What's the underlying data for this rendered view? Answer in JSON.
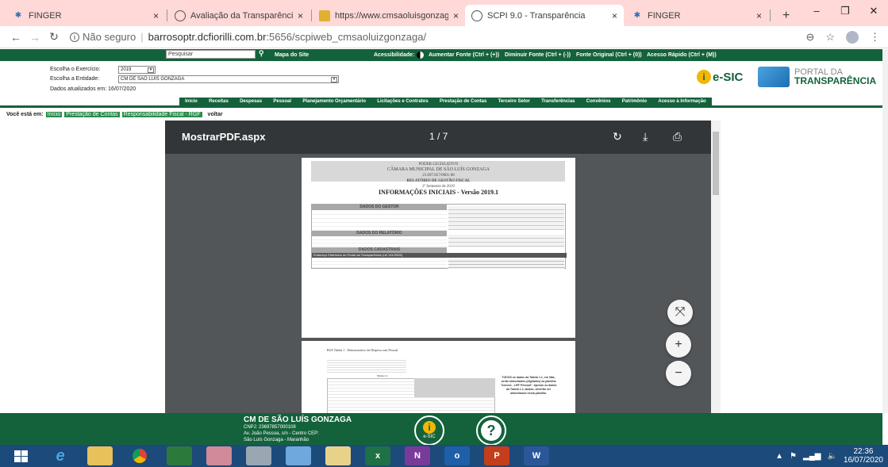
{
  "browser": {
    "tabs": [
      {
        "label": "FINGER",
        "close": "×"
      },
      {
        "label": "Avaliação da Transparência dos",
        "close": "×"
      },
      {
        "label": "https://www.cmsaoluisgonzaga",
        "close": "×"
      },
      {
        "label": "SCPI 9.0 - Transparência",
        "close": "×"
      },
      {
        "label": "FINGER",
        "close": "×"
      }
    ],
    "new_tab": "+",
    "window_controls": [
      "–",
      "❐",
      "✕"
    ],
    "security": "Não seguro",
    "url_host": "barrosoptr.dcfiorilli.com.br",
    "url_rest": ":5656/scpiweb_cmsaoluizgonzaga/"
  },
  "topstrip": {
    "search_placeholder": "Pesquisar",
    "sitemap": "Mapa do Site",
    "accessibility": "Acessibilidade:",
    "increase_font": "Aumentar Fonte (Ctrl + (+))",
    "decrease_font": "Diminuir Fonte (Ctrl + (-))",
    "original_font": "Fonte Original (Ctrl + (0))",
    "quick_access": "Acesso Rápido (Ctrl + (M))"
  },
  "header": {
    "exercise_label": "Escolha o Exercício:",
    "exercise_value": "2019",
    "entity_label": "Escolha a Entidade:",
    "entity_value": "CM DE SAO LUIS GONZAGA",
    "updated": "Dados atualizados em: 16/07/2020",
    "esic": "e-SIC",
    "portal_line1": "PORTAL DA",
    "portal_line2": "TRANSPARÊNCIA"
  },
  "menu": [
    "Início",
    "Receitas",
    "Despesas",
    "Pessoal",
    "Planejamento Orçamentário",
    "Licitações e Contratos",
    "Prestação de Contas",
    "Terceiro Setor",
    "Transferências",
    "Convênios",
    "Patrimônio",
    "Acesso à Informação"
  ],
  "breadcrumb": {
    "prefix": "Você está em:",
    "items": [
      "Início",
      "Prestação de Contas",
      "Responsabilidade Fiscal - RGF"
    ],
    "back": "voltar"
  },
  "pdf": {
    "title": "MostrarPDF.aspx",
    "pages": "1 / 7",
    "page1": {
      "org1": "PODER LEGISLATIVO",
      "org2": "CÂMARA MUNICIPAL DE SÃO LUÍS GONZAGA",
      "cnpj": "23.697.857/0001-08",
      "report": "RELATÓRIO DE GESTÃO FISCAL",
      "period": "2º Semestre de 2019",
      "heading": "INFORMAÇÕES INICIAIS - Versão 2019.1",
      "sec1": "DADOS DO GESTOR",
      "sec2": "DADOS DO RELATÓRIO",
      "sec3": "DADOS CADASTRAIS",
      "portal_row": "Endereço Eletrônico do Portal da Transparência (Lei 131/2009)"
    },
    "page2": {
      "title": "RGF Tabela 1 - Demonstrativo da Despesa com Pessoal",
      "table_label": "Tabela 1.1",
      "note": "TODOS os dados da Tabela 1.1, em lilás, serão alimentados (digitados) na planilha \"Anexo1 - LRF Pessoal\". Apenas os dados da Tabela 1.2, abaixo, deverão ser alimentados nesta planilha."
    }
  },
  "footer": {
    "name": "CM DE SÃO LUÍS GONZAGA",
    "cnpj": "CNPJ: 23697857000108",
    "address": "Av. João Pessoa, s/n - Centro CEP:",
    "city": "São Luís Gonzaga - Maranhão",
    "esic_label": "e-SIC"
  },
  "tray": {
    "time": "22:36",
    "date": "16/07/2020"
  }
}
